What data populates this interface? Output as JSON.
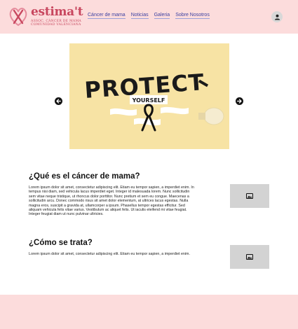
{
  "brand": {
    "name": "estima't",
    "subtitle_line1": "ASSOC. CÀNCER DE MAMA",
    "subtitle_line2": "COMUNIDAD VALENCIANA"
  },
  "nav": {
    "items": [
      {
        "label": "Cáncer de mama"
      },
      {
        "label": "Noticias"
      },
      {
        "label": "Galeria"
      },
      {
        "label": "Sobre Nosotros"
      }
    ]
  },
  "carousel": {
    "slide_title": "PROTECT",
    "slide_subtitle": "YOURSELF"
  },
  "sections": [
    {
      "title": "¿Qué es el cáncer de mama?",
      "body": "Lorem ipsum dolor sit amet, consectetur adipiscing elit. Etiam eu tempor sapien, a imperdiet enim. In tempus nisi diam, sed vehicula lacus imperdiet eget. Integer id malesuada lorem. Nunc sollicitudin sem vitae neque tristique, ut rhoncus dolor porttitor. Nunc pretium et sem eu congue. Maecenas a sollicitudin arcu. Donec commodo risus sit amet dolor elementum, at ultrices lacus egestas. Nulla magna eros, suscipit a gravida at, ullamcorper a ipsum. Phasellus tempor egestas efficitur. Sed aliquam vehicula felis vitae varius. Vestibulum ac aliquet felis. Ut iaculis eleifend mi vitae feugiat. Integer feugiat diam ut nunc pulvinar ultricies."
    },
    {
      "title": "¿Cómo se trata?",
      "body": "Lorem ipsum dolor sit amet, consectetur adipiscing elit. Etiam eu tempor sapien, a imperdiet enim."
    }
  ],
  "icons": {
    "logo": "ribbon-heart-logo",
    "profile": "person-icon",
    "prev": "arrow-left-icon",
    "next": "arrow-right-icon",
    "image_placeholder": "image-icon"
  },
  "colors": {
    "header_bg": "#fcdcdc",
    "brand": "#c8475f",
    "nav_link": "#3b3fa0",
    "slide_bg": "#f7e3a4"
  }
}
